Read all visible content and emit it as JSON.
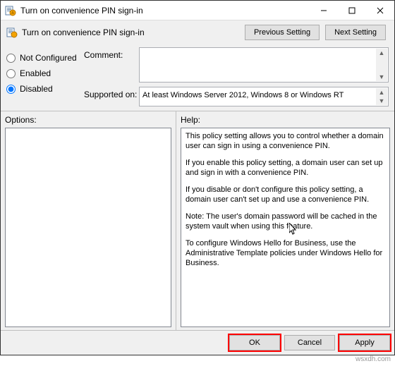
{
  "window": {
    "title": "Turn on convenience PIN sign-in"
  },
  "header": {
    "policy_name": "Turn on convenience PIN sign-in",
    "prev_label": "Previous Setting",
    "next_label": "Next Setting"
  },
  "config": {
    "not_configured_label": "Not Configured",
    "enabled_label": "Enabled",
    "disabled_label": "Disabled",
    "selected": "disabled",
    "comment_label": "Comment:",
    "comment_value": "",
    "supported_label": "Supported on:",
    "supported_value": "At least Windows Server 2012, Windows 8 or Windows RT"
  },
  "panes": {
    "options_label": "Options:",
    "help_label": "Help:"
  },
  "help": {
    "p1": "This policy setting allows you to control whether a domain user can sign in using a convenience PIN.",
    "p2": "If you enable this policy setting, a domain user can set up and sign in with a convenience PIN.",
    "p3": "If you disable or don't configure this policy setting, a domain user can't set up and use a convenience PIN.",
    "p4": "Note: The user's domain password will be cached in the system vault when using this feature.",
    "p5": "To configure Windows Hello for Business, use the Administrative Template policies under Windows Hello for Business."
  },
  "footer": {
    "ok_label": "OK",
    "cancel_label": "Cancel",
    "apply_label": "Apply"
  },
  "watermark": "wsxdh.com"
}
